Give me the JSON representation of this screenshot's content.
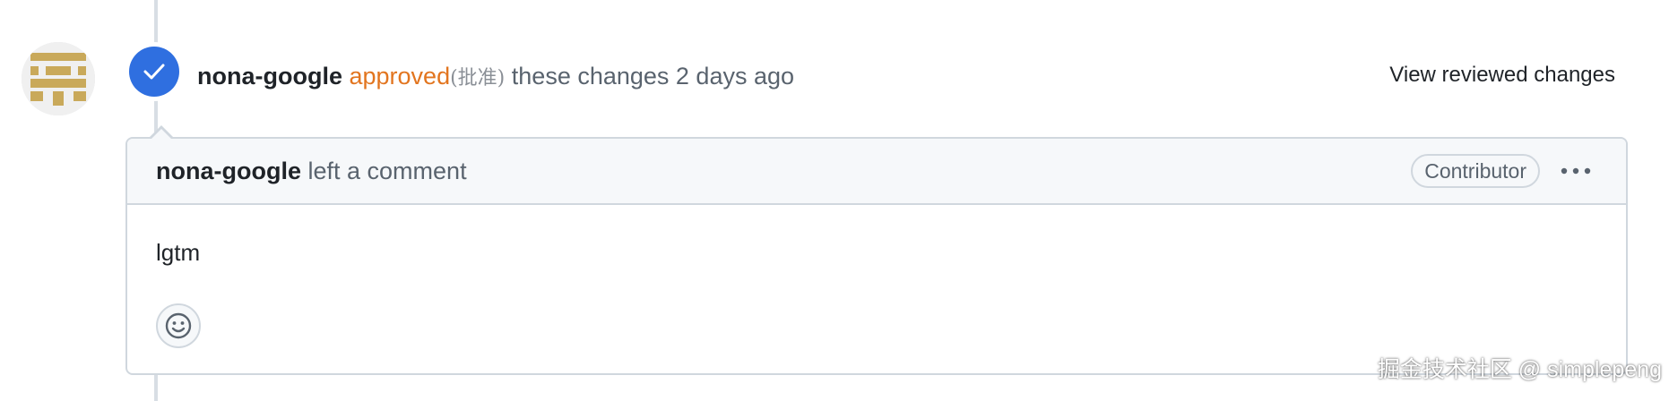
{
  "review": {
    "author": "nona-google",
    "state": "approved",
    "state_cn": "(批准)",
    "suffix": "these changes 2 days ago",
    "view_changes_label": "View reviewed changes",
    "badge_icon": "check-icon",
    "badge_color": "#2f6fe0",
    "state_color": "#e2751f"
  },
  "comment": {
    "author": "nona-google",
    "action": "left a comment",
    "role_badge": "Contributor",
    "more_icon": "kebab-horizontal-icon",
    "body": "lgtm",
    "reaction_icon": "smiley-icon"
  },
  "watermark": {
    "text": "掘金技术社区 @ simplepeng"
  },
  "avatar": {
    "icon": "identicon-avatar",
    "color": "#c9a95a"
  }
}
